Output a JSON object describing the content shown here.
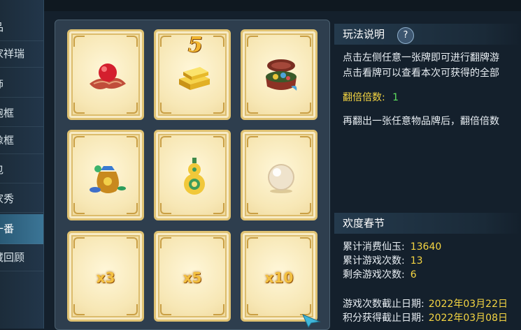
{
  "sidebar": {
    "items": [
      {
        "label": "品"
      },
      {
        "label": "家祥瑞"
      },
      {
        "label": "饰"
      },
      {
        "label": "跑框"
      },
      {
        "label": "像框"
      },
      {
        "label": "包"
      },
      {
        "label": "家秀"
      },
      {
        "label": "一番"
      },
      {
        "label": "藏回顾"
      }
    ]
  },
  "cards": [
    {
      "item": "red-gem-on-cloth-icon",
      "badge": ""
    },
    {
      "item": "gold-ingots-icon",
      "badge": "5"
    },
    {
      "item": "treasure-box-icon",
      "badge": ""
    },
    {
      "item": "money-bag-icon",
      "badge": ""
    },
    {
      "item": "gourd-icon",
      "badge": ""
    },
    {
      "item": "pearl-icon",
      "badge": ""
    },
    {
      "multiplier": "x3"
    },
    {
      "multiplier": "x5"
    },
    {
      "multiplier": "x10"
    }
  ],
  "rules": {
    "title": "玩法说明",
    "help": "?",
    "line1": "点击左侧任意一张牌即可进行翻牌游",
    "line2": "点击看牌可以查看本次可获得的全部",
    "multiplier_label": "翻倍倍数:",
    "multiplier_value": "1",
    "line3": "再翻出一张任意物品牌后，翻倍倍数"
  },
  "event": {
    "title": "欢度春节",
    "spent_label": "累计消费仙玉:",
    "spent_value": "13640",
    "plays_label": "累计游戏次数:",
    "plays_value": "13",
    "remaining_label": "剩余游戏次数:",
    "remaining_value": "6",
    "play_deadline_label": "游戏次数截止日期:",
    "play_deadline_value": "2022年03月22日",
    "score_deadline_label": "积分获得截止日期:",
    "score_deadline_value": "2022年03月08日"
  },
  "colors": {
    "accent_yellow": "#f5d542",
    "accent_green": "#5fe05f",
    "card_border": "#e0c272"
  }
}
